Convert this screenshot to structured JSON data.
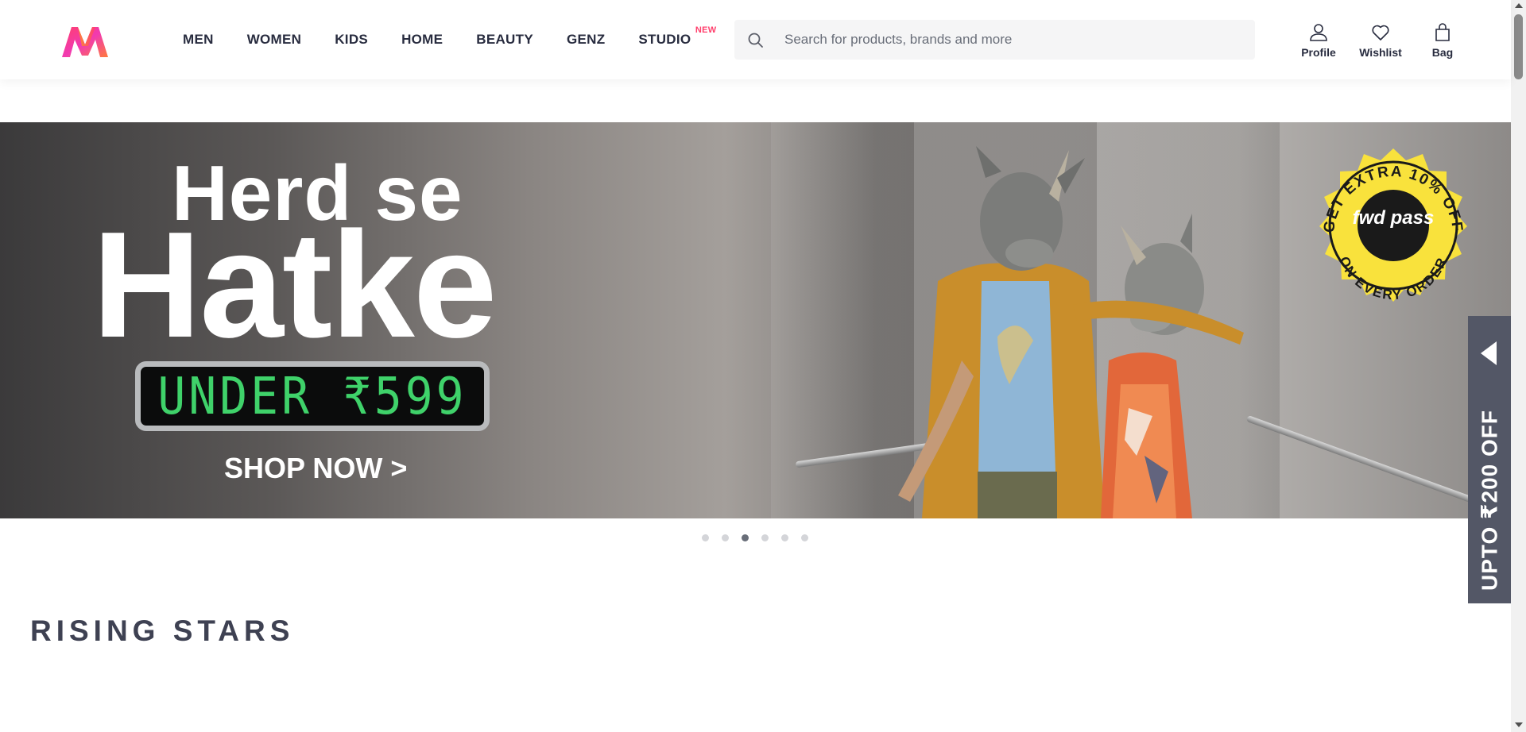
{
  "header": {
    "nav": [
      {
        "label": "MEN"
      },
      {
        "label": "WOMEN"
      },
      {
        "label": "KIDS"
      },
      {
        "label": "HOME"
      },
      {
        "label": "BEAUTY"
      },
      {
        "label": "GENZ"
      },
      {
        "label": "STUDIO",
        "tag": "NEW"
      }
    ],
    "search": {
      "placeholder": "Search for products, brands and more",
      "value": ""
    },
    "actions": {
      "profile": "Profile",
      "wishlist": "Wishlist",
      "bag": "Bag"
    }
  },
  "banner": {
    "headline_line1": "Herd se",
    "headline_line2": "Hatke",
    "price_tag": "UNDER ₹599",
    "cta": "SHOP NOW >",
    "badge": {
      "top_text": "GET EXTRA 10% OFF",
      "center_text": "fwd pass",
      "bottom_text": "ON EVERY ORDER"
    },
    "carousel": {
      "total": 6,
      "active": 3
    }
  },
  "side_offer": {
    "text": "UPTO ₹200 OFF"
  },
  "section": {
    "title": "RISING STARS"
  },
  "colors": {
    "brand_pink": "#ff3f6c",
    "nav_text": "#282c3f",
    "offer_bg": "#535766",
    "price_green": "#3fd26a"
  }
}
